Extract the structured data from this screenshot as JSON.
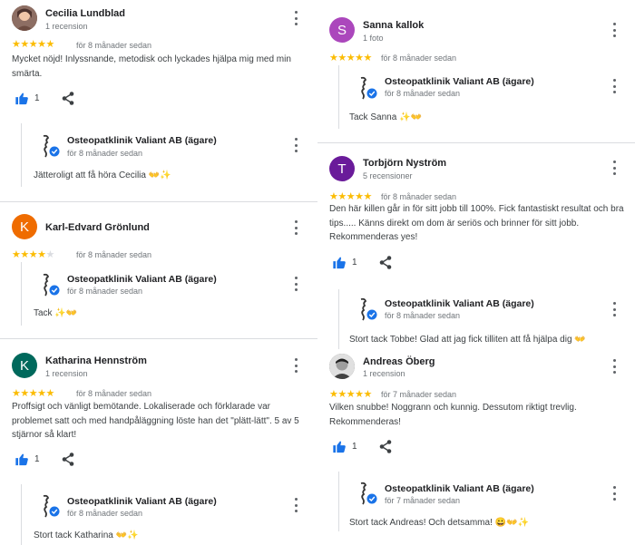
{
  "colors": {
    "star": "#fbbc04",
    "like_blue": "#1a73e8",
    "verified": "#1a73e8"
  },
  "owner": {
    "name": "Osteopatklinik Valiant AB (ägare)"
  },
  "left_reviews": [
    {
      "name": "Cecilia Lundblad",
      "sub": "1 recension",
      "avatar_color": "#7b5a4a",
      "rating": 5,
      "date": "för 8 månader sedan",
      "text": "Mycket nöjd! Inlyssnande, metodisk och lyckades hjälpa mig med min smärta.",
      "likes": "1",
      "reply_date": "för 8 månader sedan",
      "reply": "Jätteroligt att få höra Cecilia 👐✨"
    },
    {
      "name": "Karl-Edvard Grönlund",
      "sub": "",
      "avatar_letter": "K",
      "avatar_color": "#ef6c00",
      "rating": 4,
      "date": "för 8 månader sedan",
      "text": "",
      "reply_date": "för 8 månader sedan",
      "reply": "Tack ✨👐"
    },
    {
      "name": "Katharina Hennström",
      "sub": "1 recension",
      "avatar_letter": "K",
      "avatar_color": "#00695c",
      "rating": 5,
      "date": "för 8 månader sedan",
      "text": "Proffsigt och vänligt bemötande. Lokaliserade och förklarade var problemet satt och med handpåläggning löste han det \"plätt-lätt\". 5 av 5 stjärnor så klart!",
      "likes": "1",
      "reply_date": "för 8 månader sedan",
      "reply": "Stort tack Katharina 👐✨"
    }
  ],
  "right_reviews": [
    {
      "name": "Sanna kallok",
      "sub": "1 foto",
      "avatar_letter": "S",
      "avatar_color": "#ab47bc",
      "rating": 5,
      "date": "för 8 månader sedan",
      "reply_date": "för 8 månader sedan",
      "reply": "Tack Sanna ✨👐"
    },
    {
      "name": "Torbjörn Nyström",
      "sub": "5 recensioner",
      "avatar_letter": "T",
      "avatar_color": "#6a1b9a",
      "rating": 5,
      "date": "för 8 månader sedan",
      "text": "Den här killen går in för sitt jobb till 100%. Fick fantastiskt resultat och bra tips.....  Känns direkt om dom är seriös och brinner för sitt jobb. Rekommenderas yes!",
      "likes": "1",
      "reply_date": "för 8 månader sedan",
      "reply": "Stort tack Tobbe! Glad att jag fick tilliten att få hjälpa dig 👐"
    },
    {
      "name": "Andreas Öberg",
      "sub": "1 recension",
      "avatar_color": "#555555",
      "rating": 5,
      "date": "för 7 månader sedan",
      "text": "Vilken snubbe! Noggrann och kunnig. Dessutom riktigt trevlig. Rekommenderas!",
      "likes": "1",
      "reply_date": "för 7 månader sedan",
      "reply": "Stort tack Andreas! Och detsamma! 😀👐✨"
    }
  ]
}
